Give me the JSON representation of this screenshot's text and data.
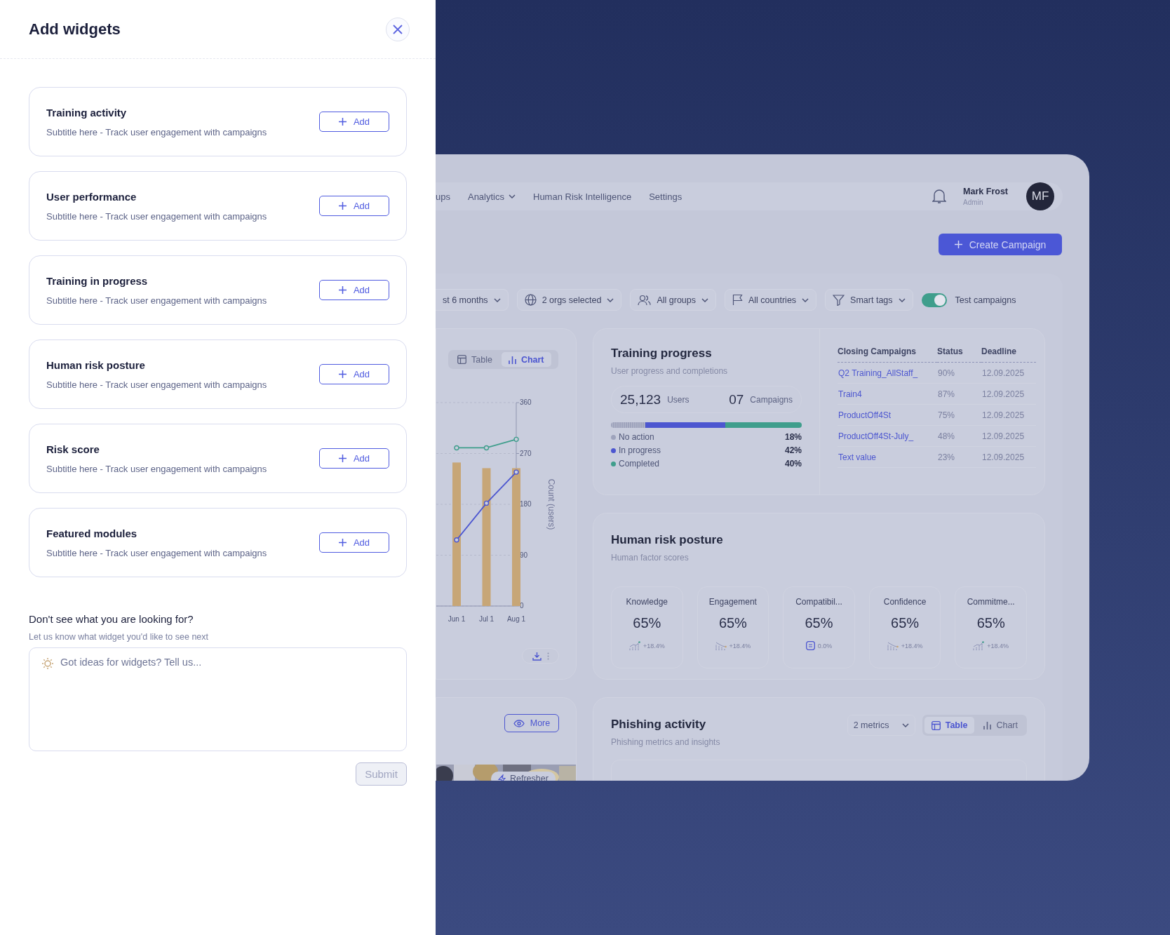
{
  "panel": {
    "title": "Add widgets",
    "widgets": [
      {
        "title": "Training activity",
        "subtitle": "Subtitle here - Track user engagement with campaigns",
        "button": "Add"
      },
      {
        "title": "User performance",
        "subtitle": "Subtitle here - Track user engagement with campaigns",
        "button": "Add"
      },
      {
        "title": "Training in progress",
        "subtitle": "Subtitle here - Track user engagement with campaigns",
        "button": "Add"
      },
      {
        "title": "Human risk posture",
        "subtitle": "Subtitle here - Track user engagement with campaigns",
        "button": "Add"
      },
      {
        "title": "Risk score",
        "subtitle": "Subtitle here - Track user engagement with campaigns",
        "button": "Add"
      },
      {
        "title": "Featured modules",
        "subtitle": "Subtitle here - Track user engagement with campaigns",
        "button": "Add"
      }
    ],
    "feedback": {
      "question": "Don't see what you are looking for?",
      "hint": "Let us know what widget you'd like to see next",
      "placeholder": "Got ideas for widgets? Tell us...",
      "submit": "Submit",
      "submit_disabled": true
    }
  },
  "dashboard": {
    "nav": [
      {
        "label": "ups",
        "dropdown": false
      },
      {
        "label": "Analytics",
        "dropdown": true
      },
      {
        "label": "Human Risk Intelligence",
        "dropdown": false
      },
      {
        "label": "Settings",
        "dropdown": false
      }
    ],
    "user": {
      "name": "Mark Frost",
      "role": "Admin",
      "initials": "MF"
    },
    "create_button": "Create Campaign",
    "filters": [
      {
        "label": "st 6 months"
      },
      {
        "label": "2 orgs selected"
      },
      {
        "label": "All groups"
      },
      {
        "label": "All countries"
      },
      {
        "label": "Smart tags"
      }
    ],
    "toggle": {
      "label": "Test campaigns",
      "on": true
    },
    "chart_card": {
      "tabs": [
        {
          "label": "Table",
          "selected": false
        },
        {
          "label": "Chart",
          "selected": true
        }
      ],
      "chart_data": {
        "type": "bar",
        "categories": [
          "Jun 1",
          "Jul 1",
          "Aug 1"
        ],
        "ylabel": "Count (users)",
        "ylim": [
          0,
          360
        ],
        "grid": true,
        "yticks": [
          0,
          90,
          180,
          270,
          360
        ],
        "series": [
          {
            "type": "bar",
            "color": "#c7a677",
            "values": [
              254,
              244,
              244
            ]
          },
          {
            "type": "line",
            "color": "#3f9e8c",
            "marker": true,
            "values": [
              280,
              280,
              295
            ]
          },
          {
            "type": "line",
            "color": "#4c56d0",
            "marker": true,
            "values": [
              117,
              182,
              237
            ]
          }
        ]
      }
    },
    "more_card": {
      "button": "More",
      "chip": "Refresher"
    },
    "training": {
      "title": "Training progress",
      "subtitle": "User progress and completions",
      "users_value": "25,123",
      "users_label": "Users",
      "campaigns_value": "07",
      "campaigns_label": "Campaigns",
      "segments": [
        {
          "label": "No action",
          "value": "18%",
          "level": 0.18,
          "color": "#9ea3bc"
        },
        {
          "label": "In progress",
          "value": "42%",
          "level": 0.42,
          "color": "#4c56d0"
        },
        {
          "label": "Completed",
          "value": "40%",
          "level": 0.4,
          "color": "#3f9e8c"
        }
      ],
      "table": {
        "columns": [
          "Closing Campaigns",
          "Status",
          "Deadline"
        ],
        "rows": [
          [
            "Q2 Training_AllStaff_",
            "90%",
            "12.09.2025"
          ],
          [
            "Train4",
            "87%",
            "12.09.2025"
          ],
          [
            "ProductOff4St",
            "75%",
            "12.09.2025"
          ],
          [
            "ProductOff4St-July_",
            "48%",
            "12.09.2025"
          ],
          [
            "Text value",
            "23%",
            "12.09.2025"
          ]
        ]
      }
    },
    "risk": {
      "title": "Human risk posture",
      "subtitle": "Human factor scores",
      "metrics": [
        {
          "label": "Knowledge",
          "value": "65%",
          "change": "+18.4%",
          "kind": "rising"
        },
        {
          "label": "Engagement",
          "value": "65%",
          "change": "+18.4%",
          "kind": "falling"
        },
        {
          "label": "Compatibil...",
          "value": "65%",
          "change": "0.0%",
          "kind": "steady"
        },
        {
          "label": "Confidence",
          "value": "65%",
          "change": "+18.4%",
          "kind": "falling"
        },
        {
          "label": "Commitme...",
          "value": "65%",
          "change": "+18.4%",
          "kind": "rising"
        }
      ]
    },
    "phishing": {
      "title": "Phishing activity",
      "subtitle": "Phishing metrics and insights",
      "select": "2 metrics",
      "tabs": [
        {
          "label": "Table",
          "selected": true
        },
        {
          "label": "Chart",
          "selected": false
        }
      ]
    }
  }
}
